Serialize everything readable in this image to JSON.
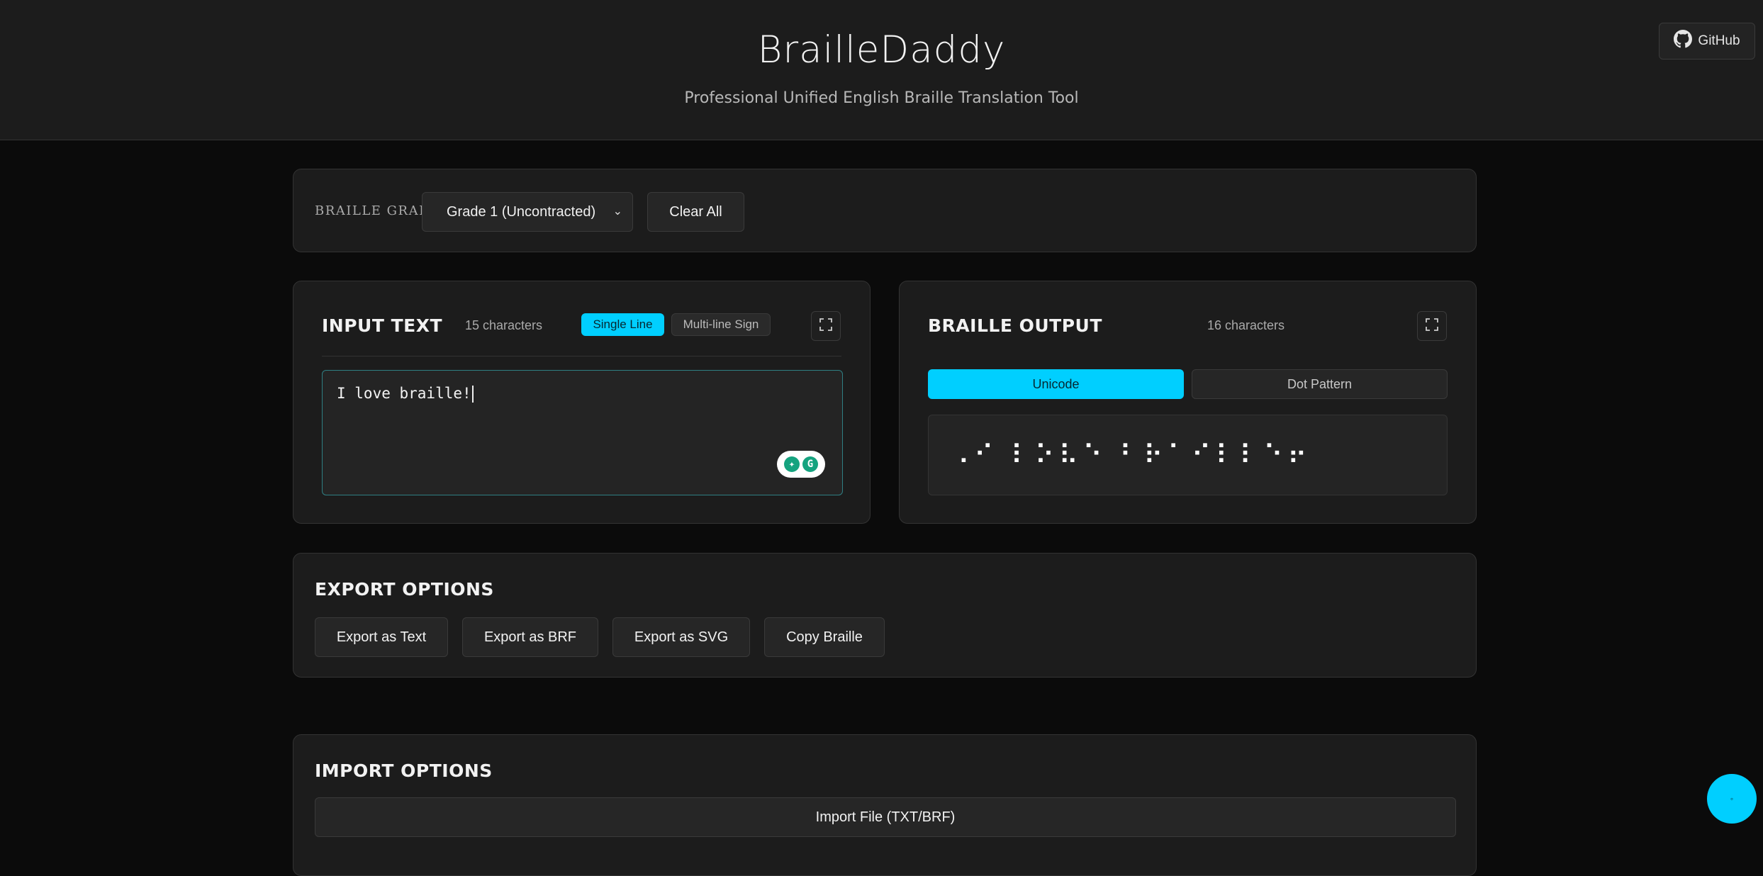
{
  "header": {
    "title": "BrailleDaddy",
    "subtitle": "Professional Unified English Braille Translation Tool",
    "github_label": "GitHub"
  },
  "settings": {
    "grade_label": "BRAILLE GRADE",
    "grade_selected": "Grade 1 (Uncontracted)",
    "clear_label": "Clear All"
  },
  "input": {
    "title": "INPUT TEXT",
    "char_count": "15 characters",
    "mode_single": "Single Line",
    "mode_multi": "Multi-line Sign",
    "value": "I love braille!"
  },
  "output": {
    "title": "BRAILLE OUTPUT",
    "char_count": "16 characters",
    "tab_unicode": "Unicode",
    "tab_dots": "Dot Pattern",
    "braille": "⠠⠊ ⠇⠕⠧⠑ ⠃⠗⠁⠊⠇⠇⠑⠖"
  },
  "export": {
    "title": "EXPORT OPTIONS",
    "buttons": [
      "Export as Text",
      "Export as BRF",
      "Export as SVG",
      "Copy Braille"
    ]
  },
  "import": {
    "title": "IMPORT OPTIONS",
    "button": "Import File (TXT/BRF)"
  },
  "colors": {
    "accent": "#00cfff",
    "background": "#0b0b0b",
    "card": "#1c1c1c"
  }
}
